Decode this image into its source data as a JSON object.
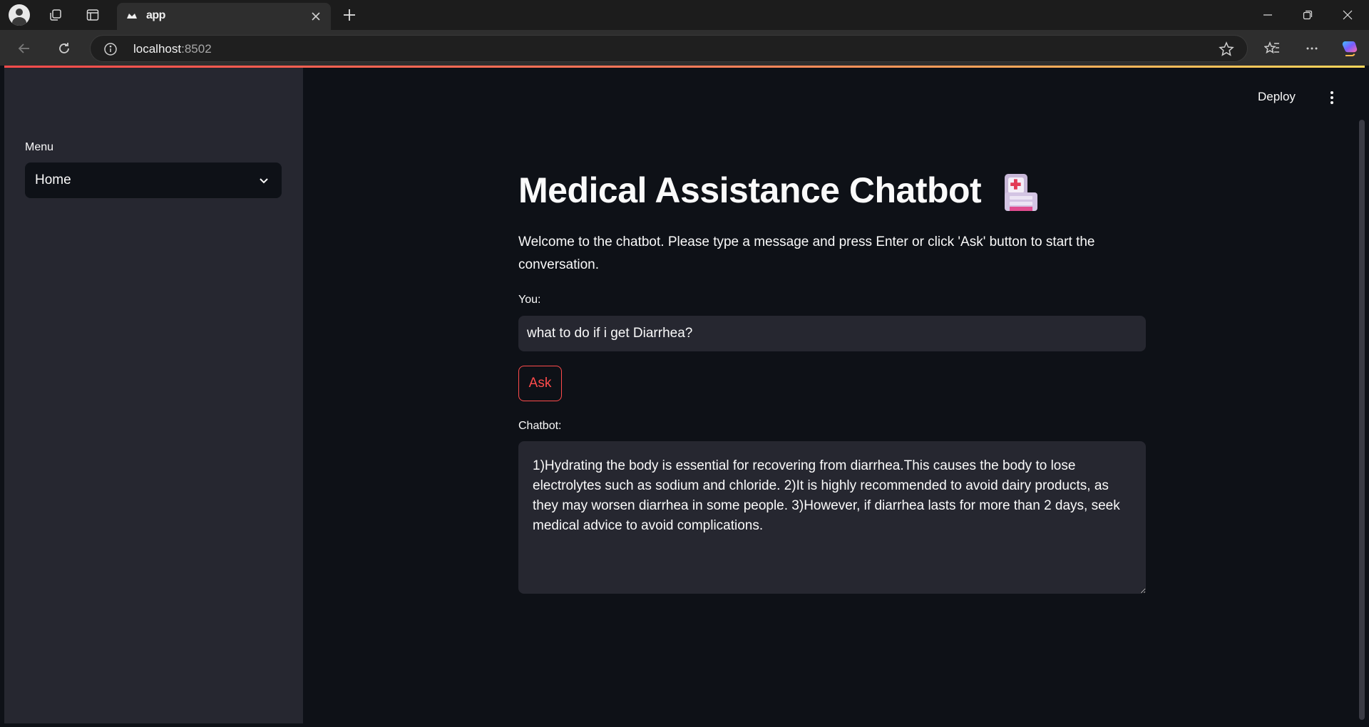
{
  "browser": {
    "tab_title": "app",
    "url_host": "localhost",
    "url_port": ":8502",
    "icons": {
      "profile": "profile-avatar-icon",
      "collections": "collections-icon",
      "tab_actions": "tab-actions-icon",
      "close_tab": "close-icon",
      "new_tab": "plus-icon",
      "back": "arrow-left-icon",
      "reload": "reload-icon",
      "site_info": "info-icon",
      "favorite": "star-icon",
      "favorites": "favorites-icon",
      "more": "more-horizontal-icon",
      "copilot": "copilot-icon"
    }
  },
  "sidebar": {
    "menu_label": "Menu",
    "menu_selected": "Home"
  },
  "header": {
    "deploy_label": "Deploy"
  },
  "main": {
    "title": "Medical Assistance Chatbot",
    "welcome_text": "Welcome to the chatbot. Please type a message and press Enter or click 'Ask' button to start the conversation.",
    "you_label": "You:",
    "you_input_value": "what to do if i get Diarrhea?",
    "ask_button_label": "Ask",
    "chatbot_label": "Chatbot:",
    "chatbot_response": "1)Hydrating the body is essential for recovering from diarrhea.This causes the body to lose electrolytes such as sodium and chloride. 2)It is highly recommended to avoid dairy products, as they may worsen diarrhea in some people. 3)However, if diarrhea lasts for more than 2 days, seek medical advice to avoid complications."
  },
  "colors": {
    "app_background": "#0e1117",
    "sidebar_background": "#262730",
    "accent": "#ff4b4b",
    "text": "#fafafa"
  }
}
